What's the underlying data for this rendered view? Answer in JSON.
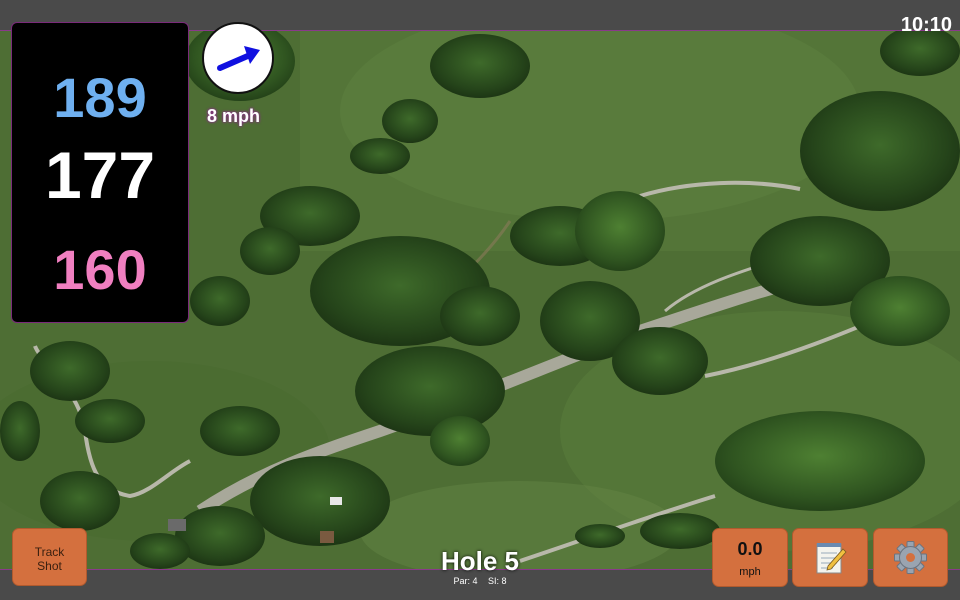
{
  "status": {
    "time": "10:10"
  },
  "yardage": {
    "back": "189",
    "middle": "177",
    "front": "160"
  },
  "wind": {
    "speed_label": "8 mph",
    "arrow_icon": "wind-arrow-icon",
    "arrow_color": "#1010e0"
  },
  "hole": {
    "title": "Hole 5",
    "par": "Par: 4",
    "si": "SI: 8"
  },
  "buttons": {
    "track_line1": "Track",
    "track_line2": "Shot",
    "speed_value": "0.0",
    "speed_unit": "mph",
    "notes_icon": "notepad-icon",
    "settings_icon": "gear-icon"
  },
  "colors": {
    "button": "#d4703e",
    "back_yardage": "#6fb0f0",
    "middle_yardage": "#ffffff",
    "front_yardage": "#f07fc0",
    "accent_border": "#8a3a8a"
  }
}
